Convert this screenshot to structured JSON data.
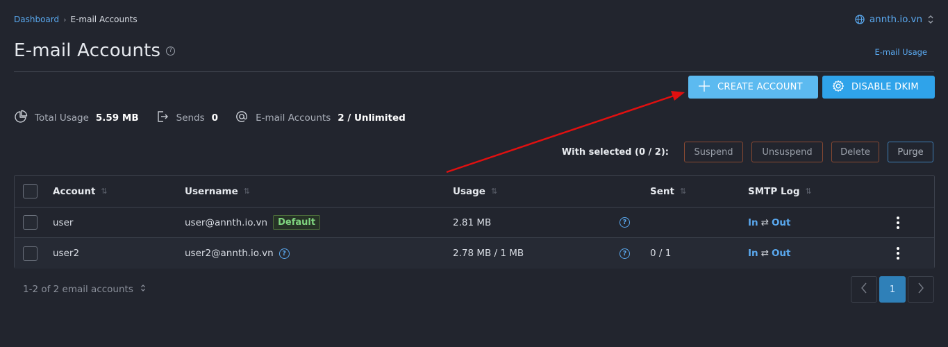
{
  "breadcrumb": {
    "root": "Dashboard",
    "separator": "›",
    "current": "E-mail Accounts"
  },
  "domain_switch": {
    "label": "annth.io.vn",
    "icon": "globe-icon"
  },
  "page": {
    "title": "E-mail Accounts",
    "help_icon": "question-circle-icon",
    "usage_link": "E-mail Usage"
  },
  "actions": {
    "create": {
      "label": "CREATE ACCOUNT",
      "icon": "plus-icon"
    },
    "dkim": {
      "label": "DISABLE DKIM",
      "icon": "gear-icon"
    }
  },
  "stats": [
    {
      "label": "Total Usage",
      "value": "5.59 MB",
      "icon": "pie-chart-icon"
    },
    {
      "label": "Sends",
      "value": "0",
      "icon": "sign-out-icon"
    },
    {
      "label": "E-mail Accounts",
      "value": "2 / Unlimited",
      "icon": "at-sign-icon"
    }
  ],
  "bulk": {
    "label": "With selected (0 / 2):",
    "buttons": [
      "Suspend",
      "Unsuspend",
      "Delete",
      "Purge"
    ]
  },
  "table": {
    "headers": [
      "Account",
      "Username",
      "Usage",
      "Sent",
      "SMTP Log"
    ],
    "rows": [
      {
        "account": "user",
        "username": "user@annth.io.vn",
        "badge": "Default",
        "usage": "2.81 MB",
        "sent": "",
        "smtp_in": "In",
        "smtp_arrows": "⇄",
        "smtp_out": "Out"
      },
      {
        "account": "user2",
        "username": "user2@annth.io.vn",
        "badge": "",
        "usage": "2.78 MB / 1 MB",
        "sent": "0 / 1",
        "smtp_in": "In",
        "smtp_arrows": "⇄",
        "smtp_out": "Out"
      }
    ]
  },
  "footer": {
    "count": "1-2 of 2 email accounts",
    "current_page": "1"
  },
  "colors": {
    "background": "#22252e",
    "accent": "#4fb3ee",
    "link": "#5aa9f0",
    "annotation_arrow": "#e01010",
    "default_badge": "#7fd47f"
  }
}
